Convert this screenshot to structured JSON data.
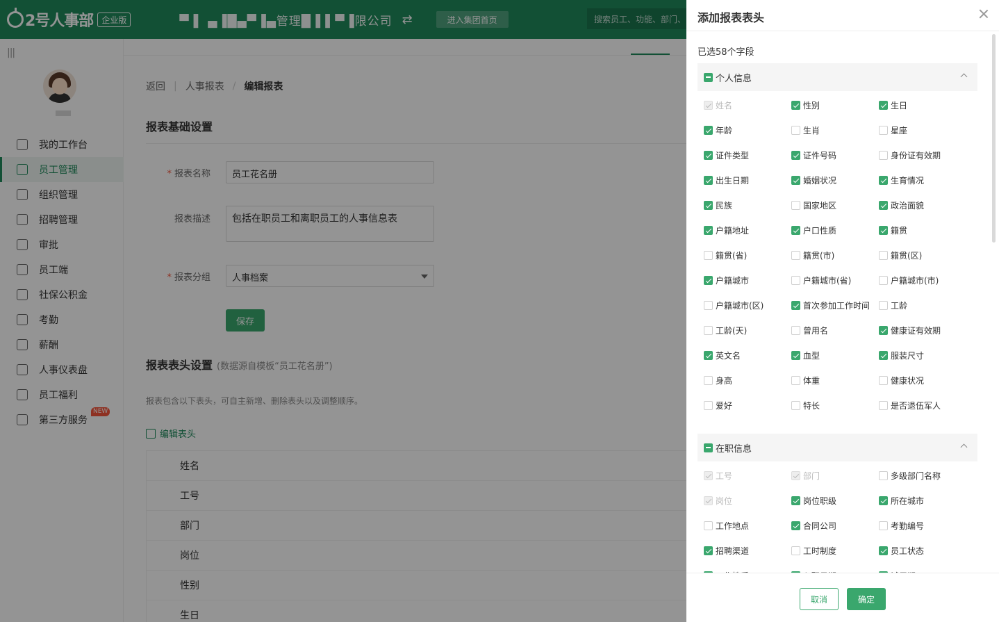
{
  "brand": {
    "logo_text": "2号人事部",
    "edition": "企业版"
  },
  "topbar": {
    "company": "▀ ▌ ▄▐█▄▀▐▄管理█▐ ▌▀▐限公司",
    "group_button": "进入集团首页",
    "search_placeholder": "搜索员工、功能、部门、"
  },
  "sidebar": {
    "items": [
      {
        "label": "我的工作台",
        "icon": "monitor-icon",
        "active": false
      },
      {
        "label": "员工管理",
        "icon": "user-card-icon",
        "active": true
      },
      {
        "label": "组织管理",
        "icon": "org-icon",
        "active": false
      },
      {
        "label": "招聘管理",
        "icon": "search-person-icon",
        "active": false
      },
      {
        "label": "审批",
        "icon": "stamp-icon",
        "active": false
      },
      {
        "label": "员工端",
        "icon": "phone-icon",
        "active": false
      },
      {
        "label": "社保公积金",
        "icon": "house-icon",
        "active": false
      },
      {
        "label": "考勤",
        "icon": "calendar-icon",
        "active": false
      },
      {
        "label": "薪酬",
        "icon": "money-icon",
        "active": false
      },
      {
        "label": "人事仪表盘",
        "icon": "dashboard-icon",
        "active": false
      },
      {
        "label": "员工福利",
        "icon": "gift-icon",
        "active": false
      },
      {
        "label": "第三方服务",
        "icon": "apps-icon",
        "active": false,
        "badge": "NEW"
      }
    ]
  },
  "breadcrumb": {
    "back": "返回",
    "parent": "人事报表",
    "current": "编辑报表"
  },
  "basic": {
    "title": "报表基础设置",
    "name_label": "报表名称",
    "name_value": "员工花名册",
    "desc_label": "报表描述",
    "desc_value": "包括在职员工和离职员工的人事信息表",
    "group_label": "报表分组",
    "group_value": "人事档案",
    "save": "保存"
  },
  "header_settings": {
    "title": "报表表头设置",
    "sub": "(数据源自模板“员工花名册”)",
    "hint": "报表包含以下表头，可自主新增、删除表头以及调整顺序。",
    "edit_link": "编辑表头",
    "fields": [
      "姓名",
      "工号",
      "部门",
      "岗位",
      "性别",
      "生日"
    ]
  },
  "drawer": {
    "title": "添加报表表头",
    "selected_count": "已选58个字段",
    "cancel": "取消",
    "ok": "确定",
    "groups": [
      {
        "name": "个人信息",
        "options": [
          {
            "label": "姓名",
            "checked": true,
            "disabled": true
          },
          {
            "label": "性别",
            "checked": true
          },
          {
            "label": "生日",
            "checked": true
          },
          {
            "label": "年龄",
            "checked": true
          },
          {
            "label": "生肖",
            "checked": false
          },
          {
            "label": "星座",
            "checked": false
          },
          {
            "label": "证件类型",
            "checked": true
          },
          {
            "label": "证件号码",
            "checked": true
          },
          {
            "label": "身份证有效期",
            "checked": false
          },
          {
            "label": "出生日期",
            "checked": true
          },
          {
            "label": "婚姻状况",
            "checked": true
          },
          {
            "label": "生育情况",
            "checked": true
          },
          {
            "label": "民族",
            "checked": true
          },
          {
            "label": "国家地区",
            "checked": false
          },
          {
            "label": "政治面貌",
            "checked": true
          },
          {
            "label": "户籍地址",
            "checked": true
          },
          {
            "label": "户口性质",
            "checked": true
          },
          {
            "label": "籍贯",
            "checked": true
          },
          {
            "label": "籍贯(省)",
            "checked": false
          },
          {
            "label": "籍贯(市)",
            "checked": false
          },
          {
            "label": "籍贯(区)",
            "checked": false
          },
          {
            "label": "户籍城市",
            "checked": true
          },
          {
            "label": "户籍城市(省)",
            "checked": false
          },
          {
            "label": "户籍城市(市)",
            "checked": false
          },
          {
            "label": "户籍城市(区)",
            "checked": false
          },
          {
            "label": "首次参加工作时间",
            "checked": true
          },
          {
            "label": "工龄",
            "checked": false
          },
          {
            "label": "工龄(天)",
            "checked": false
          },
          {
            "label": "曾用名",
            "checked": false
          },
          {
            "label": "健康证有效期",
            "checked": true
          },
          {
            "label": "英文名",
            "checked": true
          },
          {
            "label": "血型",
            "checked": true
          },
          {
            "label": "服装尺寸",
            "checked": true
          },
          {
            "label": "身高",
            "checked": false
          },
          {
            "label": "体重",
            "checked": false
          },
          {
            "label": "健康状况",
            "checked": false
          },
          {
            "label": "爱好",
            "checked": false
          },
          {
            "label": "特长",
            "checked": false
          },
          {
            "label": "是否退伍军人",
            "checked": false
          }
        ]
      },
      {
        "name": "在职信息",
        "options": [
          {
            "label": "工号",
            "checked": true,
            "disabled": true
          },
          {
            "label": "部门",
            "checked": true,
            "disabled": true
          },
          {
            "label": "多级部门名称",
            "checked": false
          },
          {
            "label": "岗位",
            "checked": true,
            "disabled": true
          },
          {
            "label": "岗位职级",
            "checked": true
          },
          {
            "label": "所在城市",
            "checked": true
          },
          {
            "label": "工作地点",
            "checked": false
          },
          {
            "label": "合同公司",
            "checked": true
          },
          {
            "label": "考勤编号",
            "checked": false
          },
          {
            "label": "招聘渠道",
            "checked": true
          },
          {
            "label": "工时制度",
            "checked": false
          },
          {
            "label": "员工状态",
            "checked": true
          },
          {
            "label": "工作性质",
            "checked": true
          },
          {
            "label": "入职日期",
            "checked": true
          },
          {
            "label": "试用期",
            "checked": true
          }
        ]
      }
    ]
  }
}
